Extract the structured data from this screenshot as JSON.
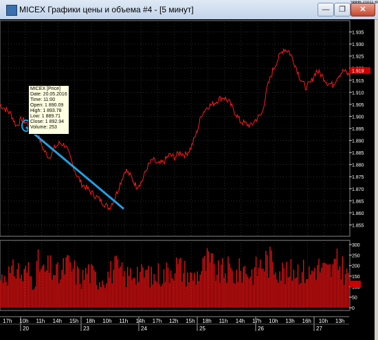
{
  "window": {
    "title": "MICEX Графики цены и объема #4 - [5 минут]",
    "ticker_strip": "SBH6 21011 BI7500",
    "buttons": {
      "minimize": "—",
      "restore": "❐",
      "close": "✕"
    }
  },
  "colors": {
    "background": "#000000",
    "price_line": "#ff1a1a",
    "volume_bars": "#e01010",
    "trendline": "#1fa3e6",
    "grid": "#4a4a4a",
    "axis_text": "#ffffff",
    "last_price_marker": "#cc0000"
  },
  "price_axis": {
    "ticks": [
      "1.935",
      "1.930",
      "1.925",
      "1.920",
      "1.915",
      "1.910",
      "1.905",
      "1.900",
      "1.895",
      "1.890",
      "1.885",
      "1.880",
      "1.875",
      "1.870",
      "1.865",
      "1.860",
      "1.855"
    ],
    "last_price_label": "1.919"
  },
  "volume_axis": {
    "ticks": [
      "300",
      "250",
      "200",
      "150",
      "100",
      "50",
      "0"
    ]
  },
  "time_axis": {
    "labels": [
      "17h",
      "10h",
      "11h",
      "14h",
      "15h",
      "18h",
      "10h",
      "11h",
      "14h",
      "17h",
      "12h",
      "15h",
      "18h",
      "11h",
      "14h",
      "17h",
      "10h",
      "13h",
      "16h",
      "10h",
      "13h"
    ],
    "dates": [
      "20",
      "23",
      "24",
      "25",
      "26",
      "27"
    ]
  },
  "tooltip": {
    "lines": [
      "MICEX [Price]",
      "Date: 20.05.2016",
      "Time: 11:00",
      "Open:  1 890.09",
      "High:  1 893.78",
      "Low:  1 889.71",
      "Close: 1 892.94",
      "Volume: 253"
    ]
  },
  "chart_data": [
    {
      "type": "line",
      "title": "MICEX [Price]",
      "y_unit": "index",
      "ylim": [
        1.852,
        1.938
      ],
      "session_dates": [
        "20",
        "23",
        "24",
        "25",
        "26",
        "27"
      ],
      "series": [
        {
          "name": "Price",
          "values": [
            1.905,
            1.903,
            1.901,
            1.896,
            1.899,
            1.897,
            1.894,
            1.892,
            1.886,
            1.883,
            1.887,
            1.889,
            1.888,
            1.882,
            1.876,
            1.872,
            1.87,
            1.868,
            1.866,
            1.864,
            1.862,
            1.866,
            1.872,
            1.878,
            1.875,
            1.871,
            1.873,
            1.879,
            1.882,
            1.88,
            1.881,
            1.884,
            1.883,
            1.885,
            1.884,
            1.887,
            1.893,
            1.901,
            1.904,
            1.905,
            1.907,
            1.908,
            1.906,
            1.902,
            1.898,
            1.897,
            1.896,
            1.899,
            1.901,
            1.912,
            1.919,
            1.924,
            1.928,
            1.927,
            1.922,
            1.916,
            1.912,
            1.914,
            1.919,
            1.917,
            1.914,
            1.913,
            1.917,
            1.919,
            1.917
          ]
        }
      ]
    },
    {
      "type": "bar",
      "title": "Volume",
      "ylim": [
        0,
        300
      ],
      "series": [
        {
          "name": "Volume",
          "values": [
            150,
            190,
            170,
            220,
            160,
            200,
            140,
            230,
            180,
            210,
            190,
            160,
            230,
            210,
            180,
            150,
            200,
            170,
            150,
            160,
            180,
            210,
            190,
            160,
            180,
            200,
            170,
            190,
            150,
            180,
            170,
            200,
            230,
            210,
            190,
            160,
            170,
            200,
            240,
            220,
            180,
            190,
            200,
            170,
            190,
            210,
            180,
            200,
            230,
            250,
            240,
            220,
            190,
            170,
            210,
            200,
            190,
            180,
            220,
            210,
            190,
            200,
            230,
            210,
            160
          ]
        }
      ]
    }
  ]
}
